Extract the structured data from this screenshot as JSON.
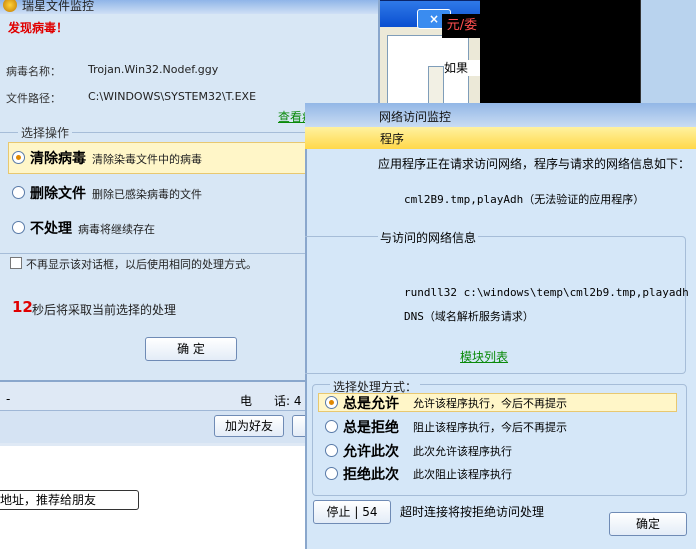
{
  "background": {
    "close_glyph": "×",
    "game_tab": "元/委",
    "partial_text": "如果",
    "right_strip_text": ""
  },
  "chat": {
    "info_dash": "-",
    "info_label": "电",
    "info_label2": "话: 4",
    "add_friend_button": "加为好友",
    "recommend_field": "地址，推荐给朋友"
  },
  "virus_dialog": {
    "title": "瑞星文件监控",
    "found_label": "发现病毒！",
    "virus_name_label": "病毒名称：",
    "virus_name_value": "Trojan.Win32.Nodef.ggy",
    "file_path_label": "文件路径：",
    "file_path_value": "C:\\WINDOWS\\SYSTEM32\\T.EXE",
    "details_link": "查看病毒详细信息",
    "choose_action_legend": "选择操作",
    "options": [
      {
        "main": "清除病毒",
        "desc": "清除染毒文件中的病毒"
      },
      {
        "main": "删除文件",
        "desc": "删除已感染病毒的文件"
      },
      {
        "main": "不处理",
        "desc": "病毒将继续存在"
      }
    ],
    "dont_show_label": "不再显示该对话框，以后使用相同的处理方式。",
    "countdown_number": "12",
    "countdown_text": "秒后将采取当前选择的处理",
    "ok_button": "确 定"
  },
  "network_dialog": {
    "title": "网络访问监控",
    "header_text": "程序",
    "intro_text": "应用程序正在请求访问网络，程序与请求的网络信息如下：",
    "app_line": "cml2B9.tmp,playAdh（无法验证的应用程序）",
    "info_legend": "与访问的网络信息",
    "process_line": "rundll32 c:\\windows\\temp\\cml2b9.tmp,playadh",
    "dns_line": "DNS（域名解析服务请求）",
    "module_link": "模块列表",
    "handle_legend": "选择处理方式：",
    "options": [
      {
        "main": "总是允许",
        "desc": "允许该程序执行，今后不再提示"
      },
      {
        "main": "总是拒绝",
        "desc": "阻止该程序执行，今后不再提示"
      },
      {
        "main": "允许此次",
        "desc": "此次允许该程序执行"
      },
      {
        "main": "拒绝此次",
        "desc": "此次阻止该程序执行"
      }
    ],
    "stop_button": "停止 | 54",
    "timeout_text": "超时连接将按拒绝访问处理",
    "ok_button": "确定"
  },
  "colors": {
    "virus_found_red": "#e00000",
    "link_green": "#0a8a0a",
    "selected_highlight": "#fff6c8"
  }
}
